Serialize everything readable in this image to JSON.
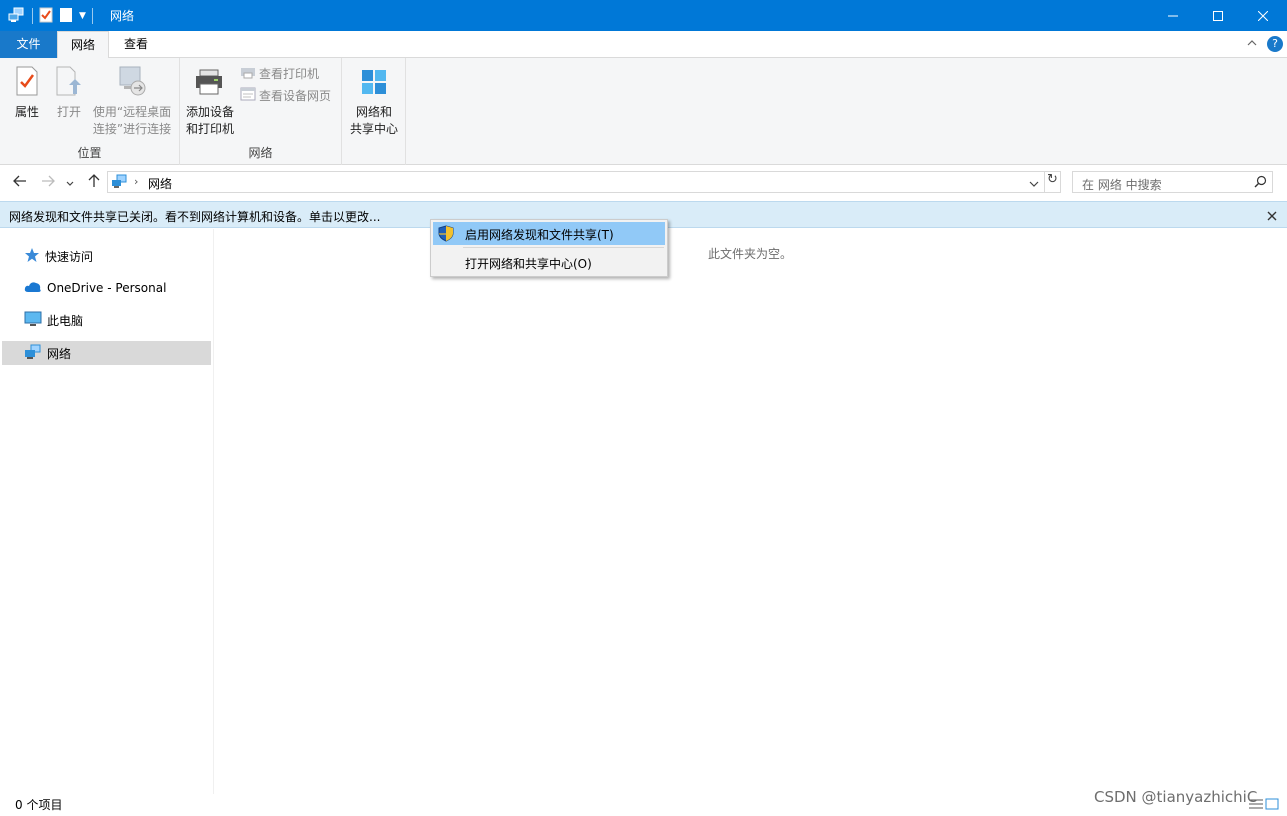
{
  "window": {
    "title": "网络"
  },
  "tabs": {
    "file": "文件",
    "network": "网络",
    "view": "查看"
  },
  "ribbon": {
    "location_group": {
      "label": "位置",
      "properties": "属性",
      "open": "打开",
      "remote_line1": "使用“远程桌面",
      "remote_line2": "连接”进行连接"
    },
    "network_group": {
      "label": "网络",
      "add_line1": "添加设备",
      "add_line2": "和打印机",
      "view_printers": "查看打印机",
      "view_device_webpage": "查看设备网页"
    },
    "center_group": {
      "line1": "网络和",
      "line2": "共享中心"
    }
  },
  "address": {
    "crumb": "网络",
    "search_placeholder": "在 网络 中搜索"
  },
  "infobar": {
    "text": "网络发现和文件共享已关闭。看不到网络计算机和设备。单击以更改..."
  },
  "navpane": {
    "items": [
      {
        "label": "快速访问",
        "icon": "star-icon"
      },
      {
        "label": "OneDrive - Personal",
        "icon": "cloud-icon"
      },
      {
        "label": "此电脑",
        "icon": "monitor-icon"
      },
      {
        "label": "网络",
        "icon": "network-icon",
        "selected": true
      }
    ]
  },
  "content": {
    "empty_text": "此文件夹为空。"
  },
  "context_menu": {
    "items": [
      {
        "label": "启用网络发现和文件共享(T)",
        "icon": "shield-icon",
        "highlighted": true
      },
      {
        "label": "打开网络和共享中心(O)"
      }
    ]
  },
  "status": {
    "count": "0 个项目"
  },
  "watermark": "CSDN @tianyazhichiC",
  "colors": {
    "titlebar": "#0078d7",
    "file_tab": "#1979ca",
    "infobar": "#d9ecf8",
    "menu_highlight": "#91c9f7"
  }
}
